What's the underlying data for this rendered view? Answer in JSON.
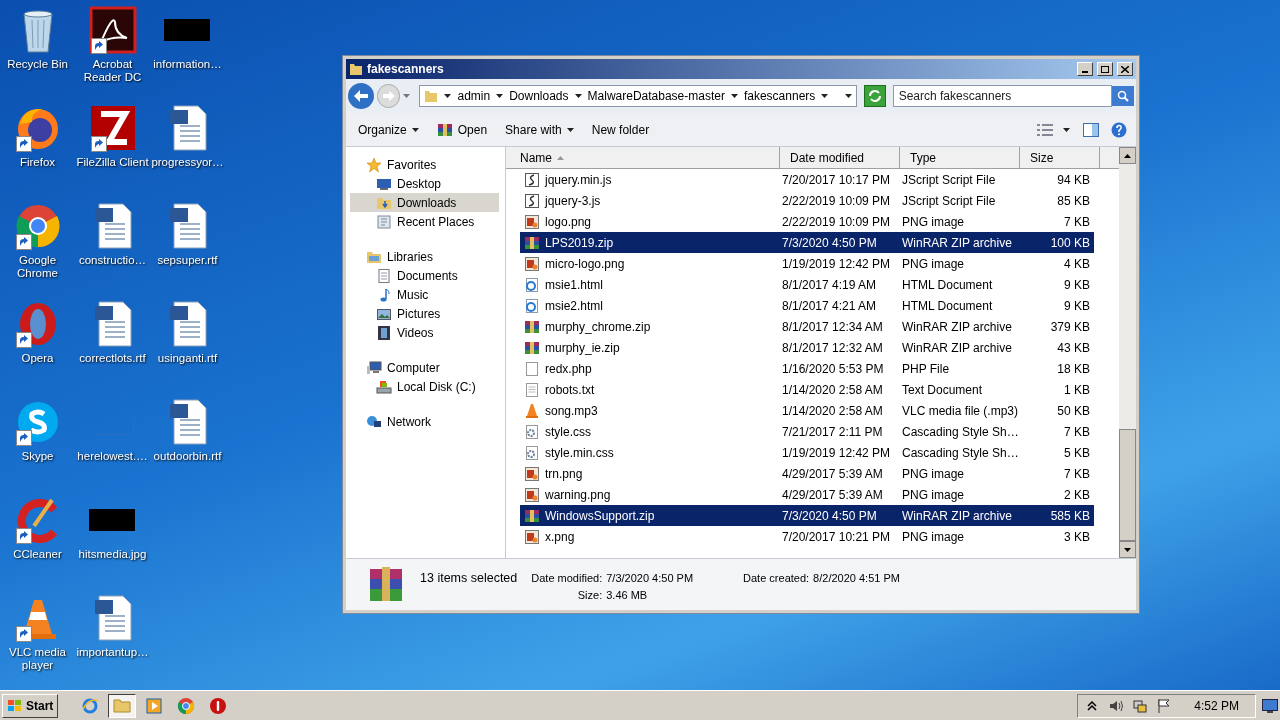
{
  "desktop": {
    "icons": [
      {
        "label": "Recycle Bin",
        "kind": "recycle",
        "shortcut": false
      },
      {
        "label": "Firefox",
        "kind": "firefox",
        "shortcut": true
      },
      {
        "label": "Google Chrome",
        "kind": "chrome",
        "shortcut": true
      },
      {
        "label": "Opera",
        "kind": "opera",
        "shortcut": true
      },
      {
        "label": "Skype",
        "kind": "skype",
        "shortcut": true
      },
      {
        "label": "CCleaner",
        "kind": "ccleaner",
        "shortcut": true
      },
      {
        "label": "VLC media player",
        "kind": "vlc",
        "shortcut": true
      },
      {
        "label": "Acrobat Reader DC",
        "kind": "acrobat",
        "shortcut": true
      },
      {
        "label": "FileZilla Client",
        "kind": "filezilla",
        "shortcut": true
      },
      {
        "label": "constructio…",
        "kind": "word",
        "shortcut": false
      },
      {
        "label": "correctlots.rtf",
        "kind": "word",
        "shortcut": false
      },
      {
        "label": "herelowest.…",
        "kind": "blank",
        "shortcut": false
      },
      {
        "label": "hitsmedia.jpg",
        "kind": "redacted",
        "shortcut": false
      },
      {
        "label": "importantup…",
        "kind": "word",
        "shortcut": false
      },
      {
        "label": "information…",
        "kind": "redacted",
        "shortcut": false
      },
      {
        "label": "progressyor…",
        "kind": "word",
        "shortcut": false
      },
      {
        "label": "sepsuper.rtf",
        "kind": "word",
        "shortcut": false
      },
      {
        "label": "usinganti.rtf",
        "kind": "word",
        "shortcut": false
      },
      {
        "label": "outdoorbin.rtf",
        "kind": "word",
        "shortcut": false
      }
    ]
  },
  "window": {
    "title": "fakescanners",
    "address": {
      "crumbs": [
        "admin",
        "Downloads",
        "MalwareDatabase-master",
        "fakescanners"
      ],
      "search_placeholder": "Search fakescanners"
    },
    "toolbar": [
      {
        "label": "Organize",
        "kind": "menu"
      },
      {
        "label": "Open",
        "kind": "open"
      },
      {
        "label": "Share with",
        "kind": "menu"
      },
      {
        "label": "New folder",
        "kind": "plain"
      }
    ],
    "nav": [
      {
        "label": "Favorites",
        "kind": "star",
        "selected": false,
        "children": [
          {
            "label": "Desktop",
            "kind": "desktop",
            "selected": false
          },
          {
            "label": "Downloads",
            "kind": "downloads",
            "selected": true
          },
          {
            "label": "Recent Places",
            "kind": "recent",
            "selected": false
          }
        ]
      },
      {
        "label": "Libraries",
        "kind": "library",
        "selected": false,
        "children": [
          {
            "label": "Documents",
            "kind": "documents",
            "selected": false
          },
          {
            "label": "Music",
            "kind": "music",
            "selected": false
          },
          {
            "label": "Pictures",
            "kind": "pictures",
            "selected": false
          },
          {
            "label": "Videos",
            "kind": "videos",
            "selected": false
          }
        ]
      },
      {
        "label": "Computer",
        "kind": "computer",
        "selected": false,
        "children": [
          {
            "label": "Local Disk (C:)",
            "kind": "disk",
            "selected": false
          }
        ]
      },
      {
        "label": "Network",
        "kind": "network",
        "selected": false
      }
    ],
    "columns": [
      {
        "label": "Name",
        "sorted": true
      },
      {
        "label": "Date modified",
        "sorted": false
      },
      {
        "label": "Type",
        "sorted": false
      },
      {
        "label": "Size",
        "sorted": false
      }
    ],
    "files": [
      {
        "name": "jquery.min.js",
        "date": "7/20/2017 10:17 PM",
        "type": "JScript Script File",
        "size": "94 KB",
        "kind": "js",
        "selected": false
      },
      {
        "name": "jquery-3.js",
        "date": "2/22/2019 10:09 PM",
        "type": "JScript Script File",
        "size": "85 KB",
        "kind": "js",
        "selected": false
      },
      {
        "name": "logo.png",
        "date": "2/22/2019 10:09 PM",
        "type": "PNG image",
        "size": "7 KB",
        "kind": "png",
        "selected": false
      },
      {
        "name": "LPS2019.zip",
        "date": "7/3/2020 4:50 PM",
        "type": "WinRAR ZIP archive",
        "size": "100 KB",
        "kind": "zip",
        "selected": true
      },
      {
        "name": "micro-logo.png",
        "date": "1/19/2019 12:42 PM",
        "type": "PNG image",
        "size": "4 KB",
        "kind": "png",
        "selected": false
      },
      {
        "name": "msie1.html",
        "date": "8/1/2017 4:19 AM",
        "type": "HTML Document",
        "size": "9 KB",
        "kind": "html",
        "selected": false
      },
      {
        "name": "msie2.html",
        "date": "8/1/2017 4:21 AM",
        "type": "HTML Document",
        "size": "9 KB",
        "kind": "html",
        "selected": false
      },
      {
        "name": "murphy_chrome.zip",
        "date": "8/1/2017 12:34 AM",
        "type": "WinRAR ZIP archive",
        "size": "379 KB",
        "kind": "zip",
        "selected": false
      },
      {
        "name": "murphy_ie.zip",
        "date": "8/1/2017 12:32 AM",
        "type": "WinRAR ZIP archive",
        "size": "43 KB",
        "kind": "zip",
        "selected": false
      },
      {
        "name": "redx.php",
        "date": "1/16/2020 5:53 PM",
        "type": "PHP File",
        "size": "18 KB",
        "kind": "blank",
        "selected": false
      },
      {
        "name": "robots.txt",
        "date": "1/14/2020 2:58 AM",
        "type": "Text Document",
        "size": "1 KB",
        "kind": "txt",
        "selected": false
      },
      {
        "name": "song.mp3",
        "date": "1/14/2020 2:58 AM",
        "type": "VLC media file (.mp3)",
        "size": "50 KB",
        "kind": "vlc",
        "selected": false
      },
      {
        "name": "style.css",
        "date": "7/21/2017 2:11 PM",
        "type": "Cascading Style Sh…",
        "size": "7 KB",
        "kind": "css",
        "selected": false
      },
      {
        "name": "style.min.css",
        "date": "1/19/2019 12:42 PM",
        "type": "Cascading Style Sh…",
        "size": "5 KB",
        "kind": "css",
        "selected": false
      },
      {
        "name": "trn.png",
        "date": "4/29/2017 5:39 AM",
        "type": "PNG image",
        "size": "7 KB",
        "kind": "png",
        "selected": false
      },
      {
        "name": "warning.png",
        "date": "4/29/2017 5:39 AM",
        "type": "PNG image",
        "size": "2 KB",
        "kind": "png",
        "selected": false
      },
      {
        "name": "WindowsSupport.zip",
        "date": "7/3/2020 4:50 PM",
        "type": "WinRAR ZIP archive",
        "size": "585 KB",
        "kind": "zip",
        "selected": true
      },
      {
        "name": "x.png",
        "date": "7/20/2017 10:21 PM",
        "type": "PNG image",
        "size": "3 KB",
        "kind": "png",
        "selected": false
      }
    ],
    "details": {
      "summary": "13 items selected",
      "fields": [
        {
          "label": "Date modified:",
          "value": "7/3/2020 4:50 PM"
        },
        {
          "label": "Size:",
          "value": "3.46 MB"
        },
        {
          "label": "Date created:",
          "value": "8/2/2020 4:51 PM"
        }
      ]
    }
  },
  "taskbar": {
    "start": "Start",
    "apps": [
      {
        "kind": "ie",
        "active": false
      },
      {
        "kind": "explorer",
        "active": true
      },
      {
        "kind": "media",
        "active": false
      },
      {
        "kind": "chrome",
        "active": false
      },
      {
        "kind": "stop",
        "active": false
      }
    ],
    "tray": [
      {
        "kind": "chevron"
      },
      {
        "kind": "speaker"
      },
      {
        "kind": "network"
      },
      {
        "kind": "flag"
      }
    ],
    "clock": "4:52 PM"
  }
}
